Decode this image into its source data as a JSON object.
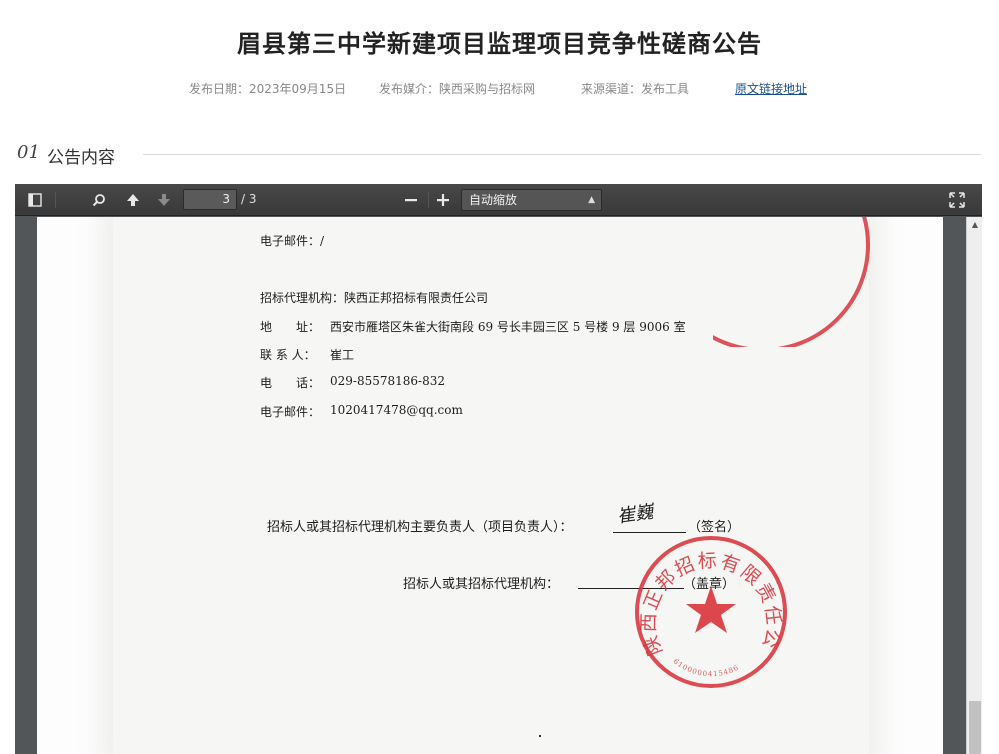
{
  "page": {
    "title": "眉县第三中学新建项目监理项目竞争性磋商公告",
    "meta": {
      "publish_date": "发布日期：2023年09月15日",
      "media": "发布媒介：陕西采购与招标网",
      "source": "来源渠道：发布工具",
      "original_link": "原文链接地址"
    },
    "section": {
      "number": "01",
      "title": "公告内容"
    }
  },
  "viewer": {
    "toolbar": {
      "current_page": "3",
      "total_pages": "/ 3",
      "zoom_label": "自动缩放",
      "icons": [
        "sidebar-toggle-icon",
        "search-icon",
        "arrow-up-icon",
        "arrow-down-icon",
        "minus-icon",
        "plus-icon",
        "fullscreen-icon"
      ]
    },
    "document": {
      "email_top": "电子邮件：/",
      "agency": "招标代理机构：陕西正邦招标有限责任公司",
      "address_label": "地　　址：",
      "address_value": "西安市雁塔区朱雀大街南段 69 号长丰园三区 5 号楼 9 层 9006 室",
      "contact_label": "联 系 人：",
      "contact_value": "崔工",
      "phone_label": "电　　话：",
      "phone_value": "029-85578186-832",
      "email_label": "电子邮件：",
      "email_value": "1020417478@qq.com",
      "responsible_line": "招标人或其招标代理机构主要负责人（项目负责人）：",
      "signature": "崔巍",
      "sign_suffix": "（签名）",
      "agency_line": "招标人或其招标代理机构：",
      "seal_suffix": "（盖章）",
      "seal_text": "陕西正邦招标有限责任公司",
      "seal_code": "6100000415486",
      "seal_color": "#d9343c"
    }
  }
}
